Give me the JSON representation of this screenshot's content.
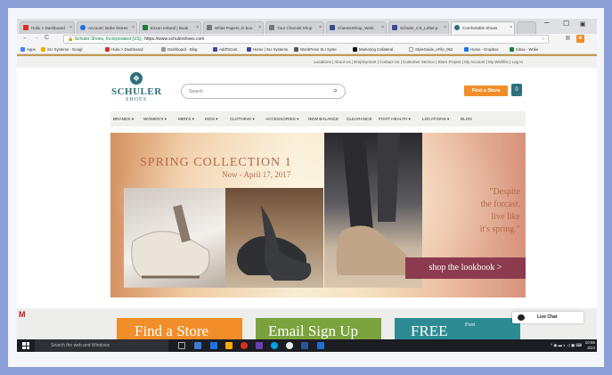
{
  "browser": {
    "tabs": [
      {
        "label": "Hulix > Dashboard",
        "color": "#d93025"
      },
      {
        "label": "Account: Bebe Stores",
        "color": "#1a73e8"
      },
      {
        "label": "Exxon Ireland | Book",
        "color": "#188038"
      },
      {
        "label": "White Papers, E-boo",
        "color": "#777777"
      },
      {
        "label": "Your Chemist Shop",
        "color": "#777777"
      },
      {
        "label": "ChemistShop_Webi",
        "color": "#3c4b9c"
      },
      {
        "label": "Schuler_CS_Letter.p",
        "color": "#3c4b9c"
      },
      {
        "label": "Comfortable Shoes",
        "color": "#2d6f7a"
      }
    ],
    "window_controls": {
      "minimize": "–",
      "maximize": "☐"
    },
    "nav": {
      "back": "←",
      "forward": "→",
      "reload": "C"
    },
    "address": {
      "secure_label": "Schuler Shoes, Incorporated [US]",
      "separator": "|",
      "url": "https://www.schulershoes.com"
    },
    "bookmarks": [
      {
        "label": "Apps",
        "color": "#4285f4"
      },
      {
        "label": "SLI Systems - Googl",
        "color": "#f9ab00"
      },
      {
        "label": "Hulix > Dashboard",
        "color": "#d93025"
      },
      {
        "label": "Dashboard · Blog",
        "color": "#999999"
      },
      {
        "label": "AddToCart",
        "color": "#3c4b9c"
      },
      {
        "label": "Home | SLI Systems",
        "color": "#3c4b9c"
      },
      {
        "label": "WordPress SLI Syste",
        "color": "#555555"
      },
      {
        "label": "Marketing Collateral",
        "color": "#111111"
      },
      {
        "label": "StyleGuide_eFile_062",
        "color": "#777777"
      },
      {
        "label": "Home - Dropbox",
        "color": "#1a73e8"
      },
      {
        "label": "Inbox - Wrike",
        "color": "#188038"
      }
    ]
  },
  "site": {
    "utility_links": "Locations | About Us | Employment | Contact Us | Customer Service | Store Project | My Account | My Wishlist | Log In",
    "logo": {
      "line1": "SCHULER",
      "line2": "SHOES"
    },
    "search": {
      "placeholder": "Search"
    },
    "find_store_label": "Find a Store",
    "nav": [
      "BRANDS ▾",
      "WOMEN'S ▾",
      "MEN'S ▾",
      "KIDS ▾",
      "CLOTHING ▾",
      "ACCESSORIES ▾",
      "NEW BALANCE",
      "CLEARANCE",
      "FOOT HEALTH ▾",
      "LOCATIONS ▾",
      "BLOG"
    ],
    "hero": {
      "title": "SPRING COLLECTION 1",
      "date": "Now - April 17, 2017",
      "quote_lines": [
        "\"Despite",
        "the forcast,",
        "live like",
        "it's spring.\""
      ],
      "cta": "shop the lookbook >"
    },
    "promos": [
      {
        "label": "Find a Store",
        "color": "#f18e2a"
      },
      {
        "label": "Email Sign Up",
        "color": "#7aa33d"
      },
      {
        "label": "FREE",
        "sub": "Foot",
        "color": "#2d8c93"
      }
    ],
    "live_chat": "Live Chat"
  },
  "taskbar": {
    "search_placeholder": "Search the web and Windows",
    "time": "10:56",
    "date": "3/23",
    "apps": [
      "#3a7bd5",
      "#1a73e8",
      "#f9ab00",
      "#d93025",
      "#6a3fb5",
      "#00a2ed",
      "#e9e9e9",
      "#2b579a",
      "#1f6fd1"
    ]
  }
}
